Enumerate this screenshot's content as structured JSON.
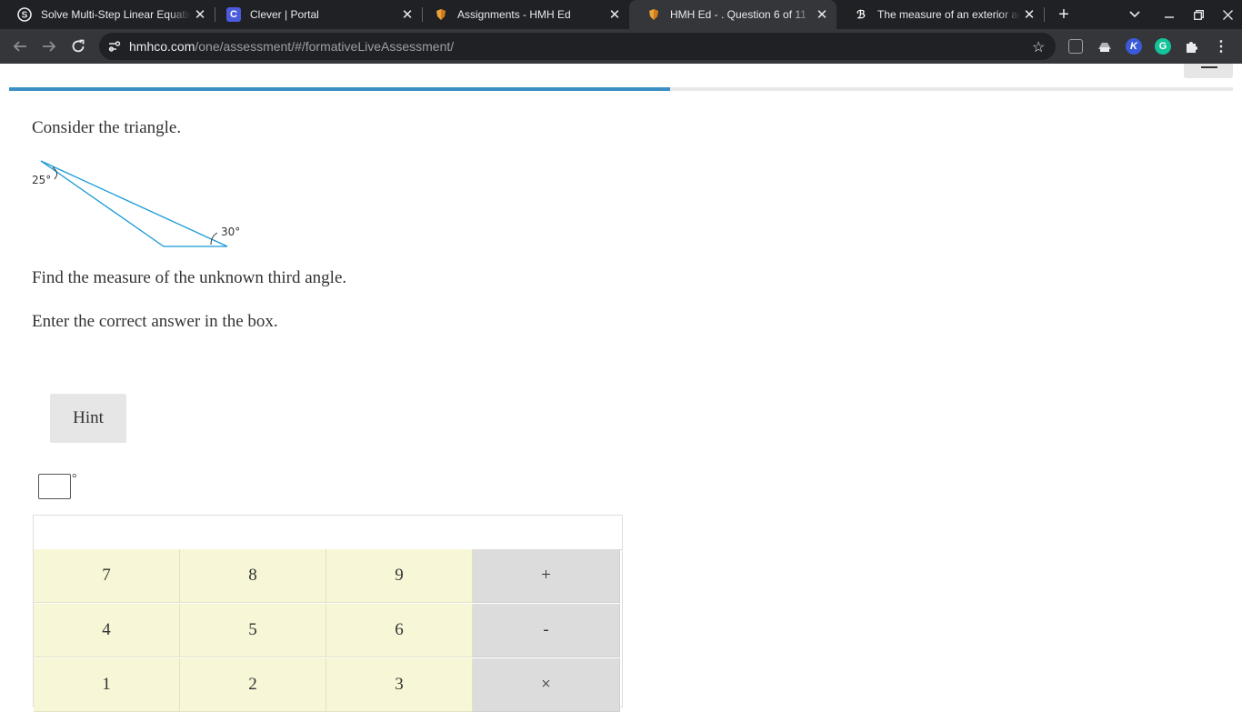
{
  "browser": {
    "tabs": [
      {
        "title": "Solve Multi-Step Linear Equatio",
        "favicon": "socratic-icon",
        "active": false
      },
      {
        "title": "Clever | Portal",
        "favicon": "clever-icon",
        "active": false
      },
      {
        "title": "Assignments - HMH Ed",
        "favicon": "hmh-icon",
        "active": false
      },
      {
        "title": "HMH Ed - . Question 6 of 11",
        "favicon": "hmh-icon",
        "active": true
      },
      {
        "title": "The measure of an exterior an",
        "favicon": "brainly-icon",
        "active": false
      }
    ],
    "url_host": "hmhco.com",
    "url_path": "/one/assessment/#/formativeLiveAssessment/"
  },
  "assessment": {
    "progress_fraction": 0.54,
    "prompt": "Consider the triangle.",
    "question": "Find the measure of the unknown third angle.",
    "instruction": "Enter the correct answer in the box.",
    "hint_label": "Hint",
    "degree_symbol": "°"
  },
  "diagram": {
    "angle_a_label": "25°",
    "angle_b_label": "30°"
  },
  "keypad": {
    "rows": [
      [
        "7",
        "8",
        "9",
        "+"
      ],
      [
        "4",
        "5",
        "6",
        "-"
      ],
      [
        "1",
        "2",
        "3",
        "×"
      ]
    ]
  },
  "colors": {
    "accent": "#3b8fc4",
    "triangle_stroke": "#1a9ad6",
    "key_number_bg": "#f7f7d7",
    "key_operator_bg": "#dcdcdc"
  }
}
